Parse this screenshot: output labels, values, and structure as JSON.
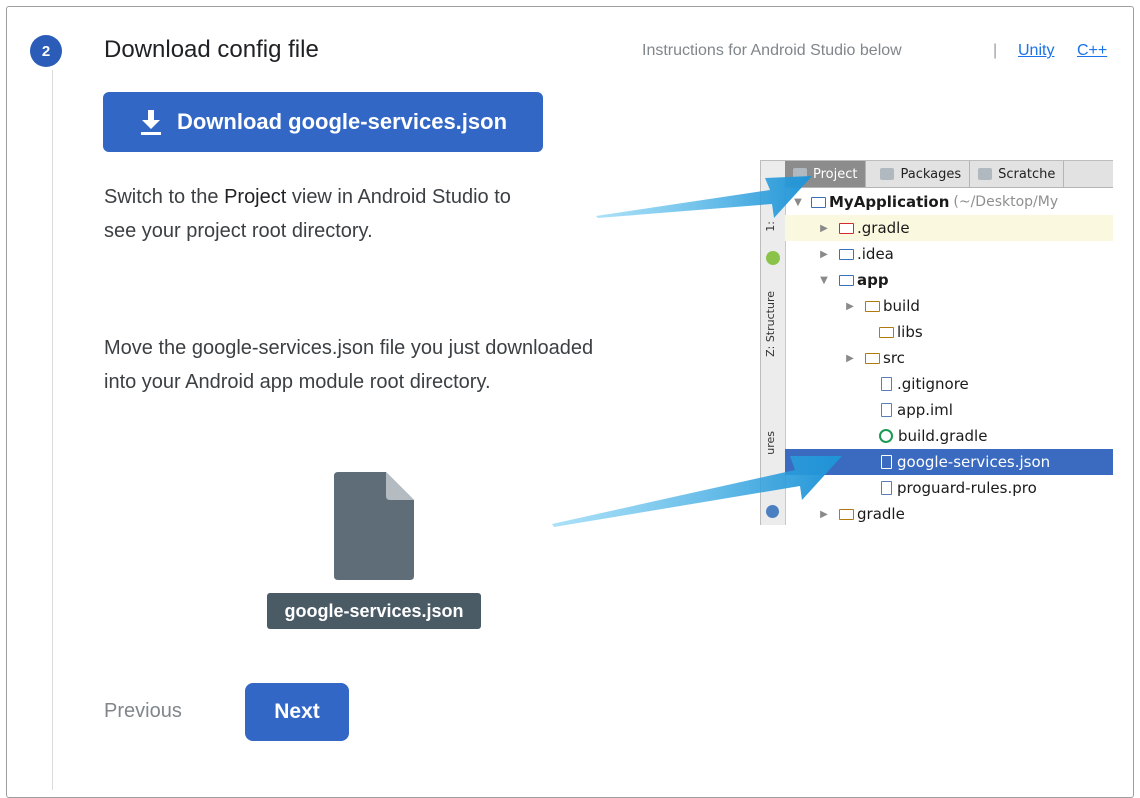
{
  "step": {
    "number": "2",
    "title": "Download config file"
  },
  "header": {
    "instructions": "Instructions for Android Studio below",
    "separator": "|",
    "link_unity": "Unity",
    "link_cpp": "C++"
  },
  "download_button": {
    "label": "Download google-services.json",
    "icon": "download-icon"
  },
  "instruction_1": {
    "before": "Switch to the ",
    "bold": "Project",
    "after": " view in Android Studio to see your project root directory."
  },
  "instruction_2": {
    "text": "Move the google-services.json file you just downloaded into your Android app module root directory."
  },
  "file_label": "google-services.json",
  "nav": {
    "previous": "Previous",
    "next": "Next"
  },
  "ide": {
    "tabs": [
      "Project",
      "Packages",
      "Scratche"
    ],
    "side_labels": [
      "1:",
      "Z: Structure",
      "ures"
    ],
    "tree": [
      {
        "label": "MyApplication",
        "hint": "(~/Desktop/My"
      },
      {
        "label": ".gradle"
      },
      {
        "label": ".idea"
      },
      {
        "label": "app"
      },
      {
        "label": "build"
      },
      {
        "label": "libs"
      },
      {
        "label": "src"
      },
      {
        "label": ".gitignore"
      },
      {
        "label": "app.iml"
      },
      {
        "label": "build.gradle"
      },
      {
        "label": "google-services.json"
      },
      {
        "label": "proguard-rules.pro"
      },
      {
        "label": "gradle"
      }
    ]
  },
  "colors": {
    "accent_blue": "#3367c6",
    "selection_blue": "#3a6bc0",
    "arrow_blue": "#29a3e0",
    "file_gray": "#4a5b66"
  }
}
